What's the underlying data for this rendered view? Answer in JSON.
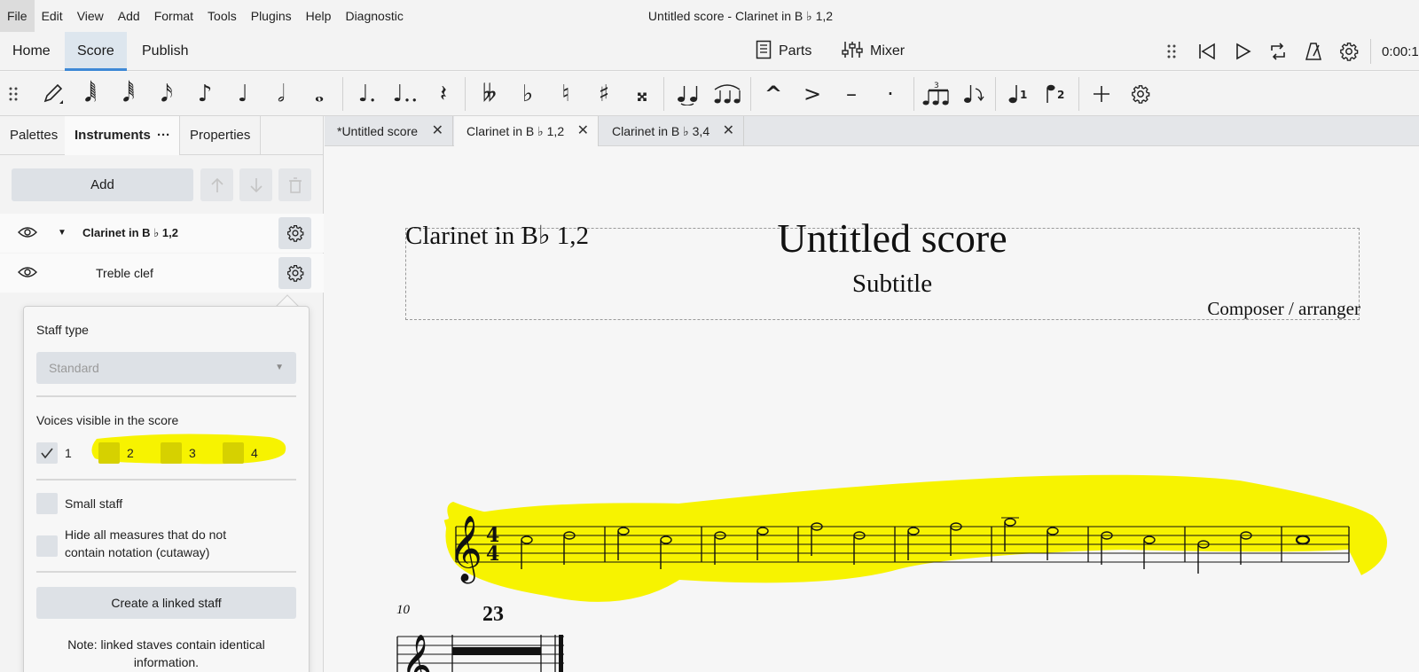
{
  "menu": {
    "items": [
      "File",
      "Edit",
      "View",
      "Add",
      "Format",
      "Tools",
      "Plugins",
      "Help",
      "Diagnostic"
    ],
    "window_title": "Untitled score - Clarinet in B ♭ 1,2"
  },
  "workspace_tabs": {
    "home": "Home",
    "score": "Score",
    "publish": "Publish"
  },
  "center": {
    "parts": "Parts",
    "mixer": "Mixer"
  },
  "playback": {
    "time": "0:00:1"
  },
  "left_panel": {
    "tabs": {
      "palettes": "Palettes",
      "instruments": "Instruments",
      "more": "···",
      "properties": "Properties"
    },
    "add_label": "Add",
    "instrument_name": "Clarinet in B ♭ 1,2",
    "staff_name": "Treble clef"
  },
  "staff_popup": {
    "staff_type_label": "Staff type",
    "staff_type_value": "Standard",
    "voices_label": "Voices visible in the score",
    "voices": [
      "1",
      "2",
      "3",
      "4"
    ],
    "small_staff": "Small staff",
    "hide_measures_line1": "Hide all measures that do not",
    "hide_measures_line2": "contain notation (cutaway)",
    "create_linked": "Create a linked staff",
    "note_line1": "Note: linked staves contain identical",
    "note_line2": "information."
  },
  "doc_tabs": [
    "*Untitled score",
    "Clarinet in B ♭ 1,2",
    "Clarinet in B ♭ 3,4"
  ],
  "score": {
    "part_name": "Clarinet in B♭ 1,2",
    "title": "Untitled score",
    "subtitle": "Subtitle",
    "composer": "Composer / arranger",
    "time_signature": "4/4",
    "measure_number": "10",
    "multirest_count": "23"
  },
  "colors": {
    "highlight": "#f7f300",
    "accent": "#3e89d6"
  },
  "toolbar_icons": [
    "drag-handle",
    "pencil",
    "64th",
    "32nd",
    "16th",
    "eighth",
    "quarter",
    "half",
    "whole",
    "dot",
    "double-dot",
    "rest",
    "double-flat",
    "flat",
    "natural",
    "sharp",
    "double-sharp",
    "tie",
    "slur",
    "marcato",
    "accent",
    "tenuto",
    "staccato",
    "tuplet",
    "flip",
    "voice-1",
    "voice-2",
    "add",
    "settings"
  ]
}
